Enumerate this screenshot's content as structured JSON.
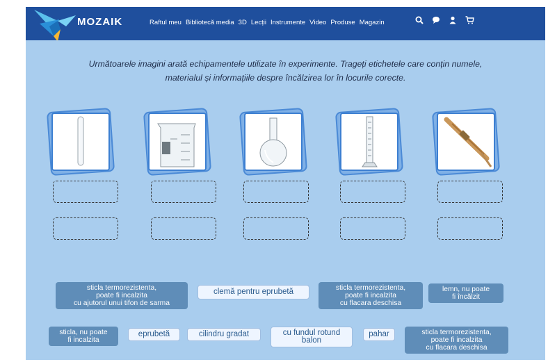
{
  "header": {
    "brand": "MOZAIK",
    "nav": [
      "Raftul meu",
      "Bibliotecă media",
      "3D",
      "Lecții",
      "Instrumente",
      "Video",
      "Produse",
      "Magazin"
    ],
    "icons": [
      "search-icon",
      "chat-icon",
      "user-icon",
      "cart-icon",
      "romania-flag-icon"
    ],
    "flag_colors": [
      "#002b7f",
      "#fcd116",
      "#ce1126"
    ]
  },
  "instructions": {
    "line1": "Următoarele imagini arată echipamentele utilizate în experimente. Trageți etichetele care conțin numele,",
    "line2": "materialul și informațiile despre încălzirea lor în locurile corecte."
  },
  "cards": [
    {
      "name": "test-tube-image"
    },
    {
      "name": "beaker-image"
    },
    {
      "name": "round-bottom-flask-image"
    },
    {
      "name": "graduated-cylinder-image"
    },
    {
      "name": "test-tube-clamp-image"
    }
  ],
  "labels": {
    "row1": [
      {
        "lines": [
          "sticla termorezistenta,",
          "poate fi incalzita",
          "cu ajutorul unui tifon de sarma"
        ]
      },
      {
        "lines": [
          "clemă pentru eprubetă"
        ]
      },
      {
        "lines": [
          "sticla termorezistenta,",
          "poate fi incalzita",
          "cu flacara deschisa"
        ]
      },
      {
        "lines": [
          "lemn, nu poate",
          "fi încălzit"
        ]
      }
    ],
    "row2": [
      {
        "lines": [
          "sticla, nu poate",
          "fi incalzita"
        ]
      },
      {
        "lines": [
          "eprubetă"
        ]
      },
      {
        "lines": [
          "cilindru gradat"
        ]
      },
      {
        "lines": [
          "cu fundul rotund",
          "balon"
        ]
      },
      {
        "lines": [
          "pahar"
        ]
      },
      {
        "lines": [
          "sticla termorezistenta,",
          "poate fi incalzita",
          "cu flacara deschisa"
        ]
      }
    ]
  }
}
